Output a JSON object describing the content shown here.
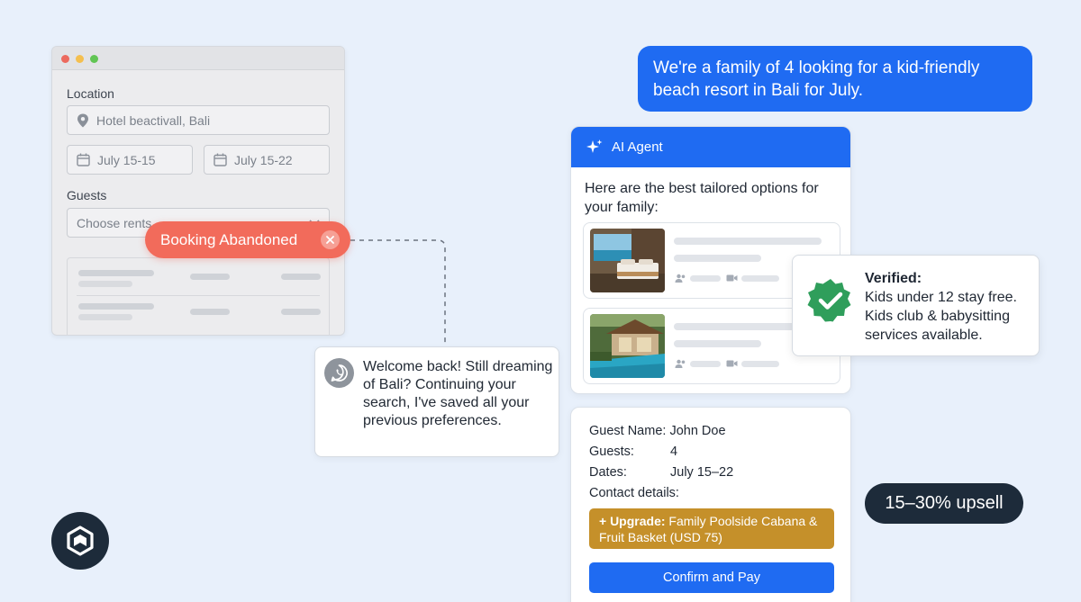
{
  "booking_form": {
    "location_label": "Location",
    "location_value": "Hotel beactivall, Bali",
    "date_from": "July 15-15",
    "date_to": "July 15-22",
    "guests_label": "Guests",
    "guests_placeholder": "Choose rents"
  },
  "abandoned": {
    "label": "Booking Abandoned"
  },
  "welcome": {
    "message": "Welcome back! Still dreaming of Bali? Continuing your search, I've saved all your previous preferences."
  },
  "user_message": {
    "text": "We're a family of 4 looking for a kid-friendly beach resort in Bali for July."
  },
  "agent": {
    "title": "AI Agent",
    "intro": "Here are the best tailored options for your family:"
  },
  "verified": {
    "heading": "Verified:",
    "line1": "Kids under 12 stay free.",
    "line2": "Kids club & babysitting services available."
  },
  "booking": {
    "guest_name_label": "Guest Name:",
    "guest_name_value": "John Doe",
    "guests_label": "Guests:",
    "guests_value": "4",
    "dates_label": "Dates:",
    "dates_value": "July 15–22",
    "contact_label": "Contact details:",
    "upgrade_prefix": "+ Upgrade:",
    "upgrade_text": " Family Poolside Cabana & Fruit Basket (USD 75)",
    "confirm_label": "Confirm and Pay"
  },
  "upsell": {
    "label": "15–30% upsell"
  },
  "colors": {
    "background": "#e8f0fb",
    "accent_blue": "#1f6bf2",
    "abandoned_red": "#f26b5b",
    "verified_green": "#2f9e5b",
    "upgrade_gold": "#c5902a",
    "dark_navy": "#1d2b3a"
  },
  "icons": {
    "location": "map-pin-icon",
    "calendar": "calendar-icon",
    "close": "close-circle-icon",
    "whatsapp": "whatsapp-icon",
    "sparkle": "sparkle-icon",
    "verified": "verified-badge-icon",
    "users": "users-icon",
    "video": "video-icon",
    "logo": "brand-logo-icon"
  }
}
